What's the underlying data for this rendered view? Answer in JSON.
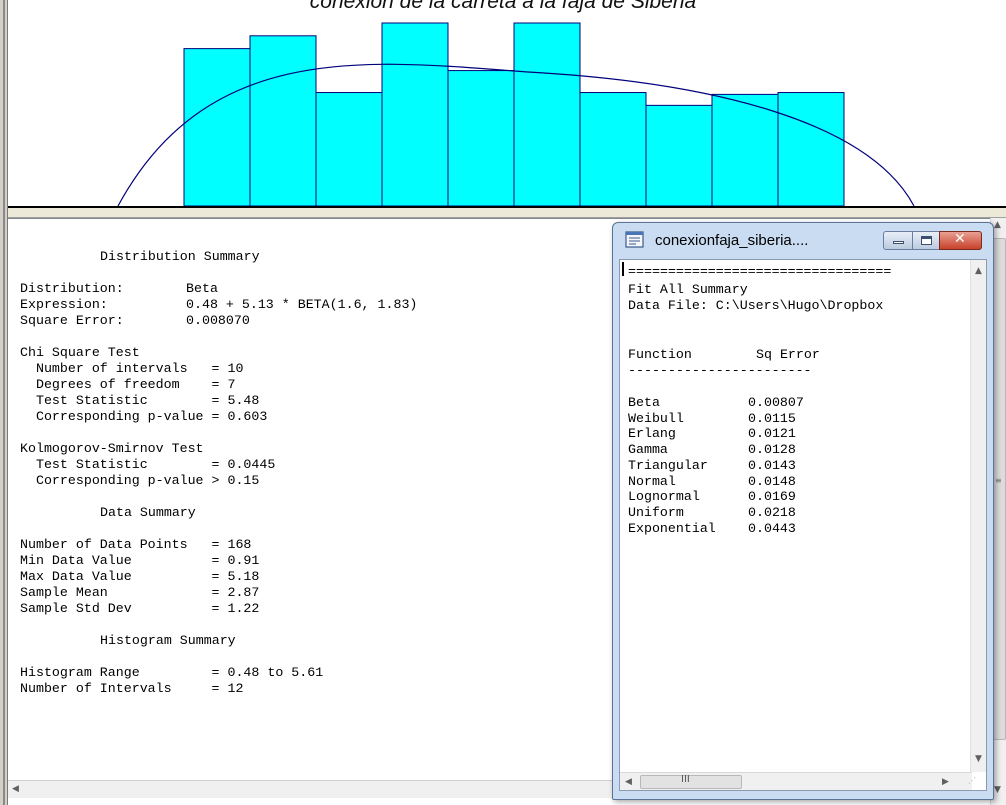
{
  "histogram": {
    "title": "conexion de la carreta a la faja de Siberia",
    "bar_color": "#00ffff",
    "bar_heights_relative": [
      0.86,
      0.93,
      0.62,
      1.0,
      0.74,
      1.0,
      0.62,
      0.55,
      0.61,
      0.62
    ]
  },
  "summary": {
    "heading": "Distribution Summary",
    "distribution_label": "Distribution:",
    "distribution_value": "Beta",
    "expression_label": "Expression:",
    "expression_value": "0.48 + 5.13 * BETA(1.6, 1.83)",
    "square_error_label": "Square Error:",
    "square_error_value": "0.008070",
    "chi_heading": "Chi Square Test",
    "chi_intervals": "  Number of intervals   = 10",
    "chi_dof": "  Degrees of freedom    = 7",
    "chi_stat": "  Test Statistic        = 5.48",
    "chi_p": "  Corresponding p-value = 0.603",
    "ks_heading": "Kolmogorov-Smirnov Test",
    "ks_stat": "  Test Statistic        = 0.0445",
    "ks_p": "  Corresponding p-value > 0.15",
    "data_heading": "Data Summary",
    "data_points": "Number of Data Points   = 168",
    "min_value": "Min Data Value          = 0.91",
    "max_value": "Max Data Value          = 5.18",
    "sample_mean": "Sample Mean             = 2.87",
    "sample_std": "Sample Std Dev          = 1.22",
    "hist_heading": "Histogram Summary",
    "hist_range": "Histogram Range         = 0.48 to 5.61",
    "hist_intervals": "Number of Intervals     = 12"
  },
  "fit_window": {
    "title": "conexionfaja_siberia....",
    "separator": "=================================",
    "header": "Fit All Summary",
    "data_file": "Data File: C:\\Users\\Hugo\\Dropbox",
    "col_function": "Function",
    "col_sq_error": "Sq Error",
    "dash_line": "-----------------------",
    "rows": [
      {
        "function": "Beta",
        "sq_error": "0.00807"
      },
      {
        "function": "Weibull",
        "sq_error": "0.0115"
      },
      {
        "function": "Erlang",
        "sq_error": "0.0121"
      },
      {
        "function": "Gamma",
        "sq_error": "0.0128"
      },
      {
        "function": "Triangular",
        "sq_error": "0.0143"
      },
      {
        "function": "Normal",
        "sq_error": "0.0148"
      },
      {
        "function": "Lognormal",
        "sq_error": "0.0169"
      },
      {
        "function": "Uniform",
        "sq_error": "0.0218"
      },
      {
        "function": "Exponential",
        "sq_error": "0.0443"
      }
    ],
    "scroll_thumb_glyph": "III"
  }
}
